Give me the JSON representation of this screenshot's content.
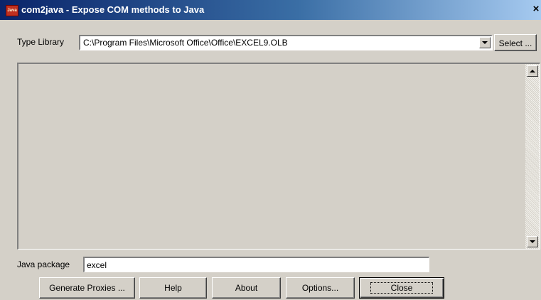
{
  "window": {
    "title": "com2java - Expose COM methods to Java",
    "icon_text": "Java",
    "close_glyph": "×"
  },
  "type_library": {
    "label": "Type Library",
    "value": "C:\\Program Files\\Microsoft Office\\Office\\EXCEL9.OLB",
    "select_label": "Select ..."
  },
  "java_package": {
    "label": "Java package",
    "value": "excel"
  },
  "buttons": {
    "generate": "Generate Proxies ...",
    "help": "Help",
    "about": "About",
    "options": "Options...",
    "close": "Close"
  }
}
